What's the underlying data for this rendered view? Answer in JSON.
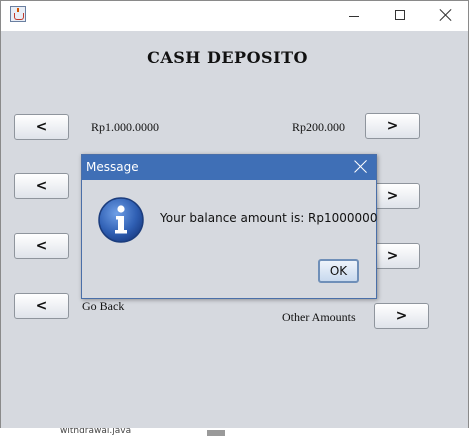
{
  "window": {
    "min_glyph": "",
    "max_glyph": "",
    "close_glyph": ""
  },
  "main": {
    "heading": "CASH DEPOSITO",
    "left_buttons": [
      "<",
      "<",
      "<",
      "<"
    ],
    "right_buttons": [
      ">",
      ">",
      ">",
      ">"
    ],
    "labels": {
      "rp1000000": "Rp1.000.0000",
      "rp200000": "Rp200.000",
      "go_back": "Go Back",
      "other_amounts": "Other Amounts"
    }
  },
  "dialog": {
    "title": "Message",
    "message": "Your balance amount is: Rp1000000",
    "ok_label": "OK",
    "icon": "info-icon"
  },
  "background_strip": {
    "text": "withdrawal.java"
  },
  "colors": {
    "dialog_title_bg": "#3f6fb6",
    "window_bg": "#d6d9df"
  }
}
